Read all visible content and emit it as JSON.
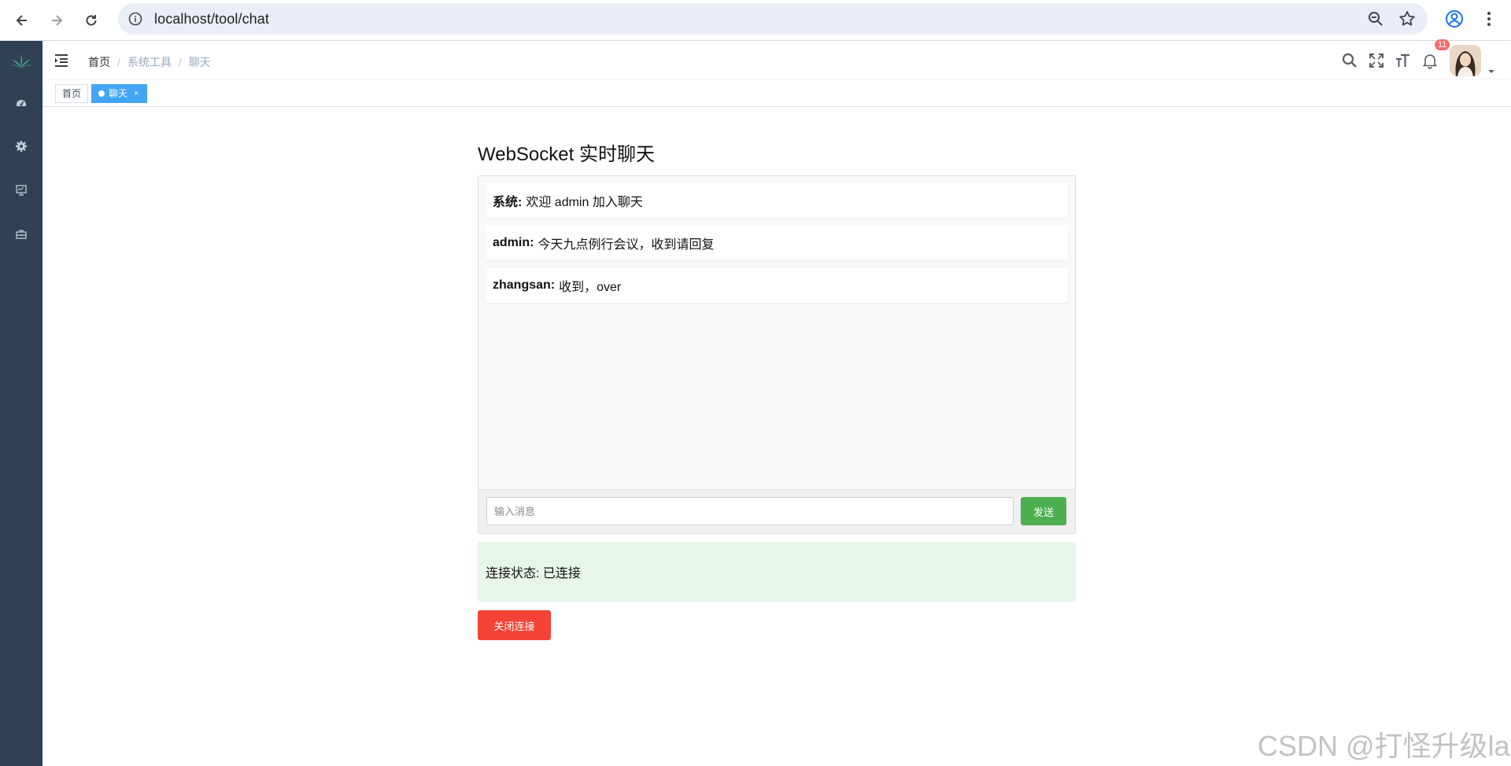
{
  "browser": {
    "url": "localhost/tool/chat"
  },
  "navbar": {
    "breadcrumb": [
      "首页",
      "系统工具",
      "聊天"
    ],
    "notification_count": "11"
  },
  "tags": {
    "home": "首页",
    "active": "聊天",
    "close": "×"
  },
  "chat": {
    "title": "WebSocket 实时聊天",
    "messages": [
      {
        "sender": "系统:",
        "text": "欢迎 admin 加入聊天"
      },
      {
        "sender": "admin:",
        "text": "今天九点例行会议，收到请回复"
      },
      {
        "sender": "zhangsan:",
        "text": "收到，over"
      }
    ],
    "input_placeholder": "输入消息",
    "input_value": "",
    "send_label": "发送",
    "status": "连接状态: 已连接",
    "close_label": "关闭连接"
  },
  "watermark": "CSDN @打怪升级la",
  "colors": {
    "sidebar": "#304156",
    "tag_active": "#42a5f5",
    "send_button": "#4caf50",
    "close_button": "#f44336",
    "status_bg": "#e8f5e9",
    "badge": "#f56c6c"
  },
  "icons": {
    "browser": [
      "back-icon",
      "forward-icon",
      "reload-icon",
      "site-info-icon",
      "zoom-icon",
      "star-icon",
      "profile-icon",
      "more-icon"
    ],
    "sidebar": [
      "logo-icon",
      "dashboard-icon",
      "settings-gear-icon",
      "monitor-icon",
      "toolbox-icon"
    ],
    "navbar": [
      "hamburger-icon",
      "search-icon",
      "fullscreen-icon",
      "font-size-icon",
      "bell-icon"
    ]
  }
}
